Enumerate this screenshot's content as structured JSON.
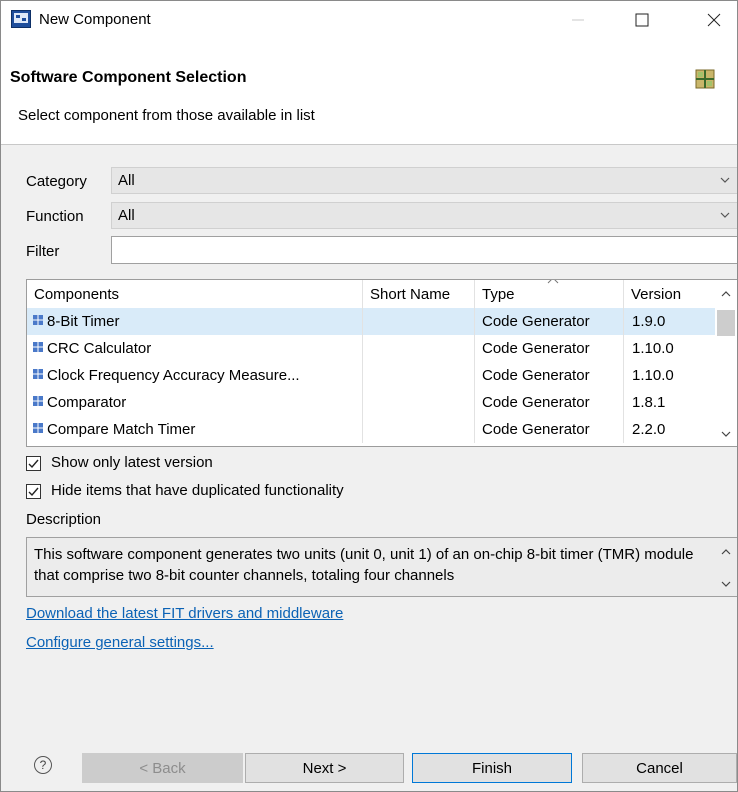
{
  "window": {
    "title": "New Component"
  },
  "banner": {
    "title": "Software Component Selection",
    "subtitle": "Select component from those available in list"
  },
  "filters": {
    "category_label": "Category",
    "category_value": "All",
    "function_label": "Function",
    "function_value": "All",
    "filter_label": "Filter",
    "filter_value": ""
  },
  "table": {
    "columns": [
      "Components",
      "Short Name",
      "Type",
      "Version"
    ],
    "rows": [
      {
        "name": "8-Bit Timer",
        "short": "",
        "type": "Code Generator",
        "version": "1.9.0",
        "selected": true
      },
      {
        "name": "CRC Calculator",
        "short": "",
        "type": "Code Generator",
        "version": "1.10.0",
        "selected": false
      },
      {
        "name": "Clock Frequency Accuracy Measure...",
        "short": "",
        "type": "Code Generator",
        "version": "1.10.0",
        "selected": false
      },
      {
        "name": "Comparator",
        "short": "",
        "type": "Code Generator",
        "version": "1.8.1",
        "selected": false
      },
      {
        "name": "Compare Match Timer",
        "short": "",
        "type": "Code Generator",
        "version": "2.2.0",
        "selected": false
      }
    ]
  },
  "options": {
    "latest_version": "Show only latest version",
    "latest_version_checked": true,
    "hide_duplicates": "Hide items that have duplicated functionality",
    "hide_duplicates_checked": true
  },
  "description": {
    "label": "Description",
    "text": "This software component generates two units (unit 0, unit 1) of an on-chip 8-bit timer (TMR) module that comprise two 8-bit counter channels, totaling four channels"
  },
  "links": {
    "download": "Download the latest FIT drivers and middleware",
    "configure": "Configure general settings..."
  },
  "buttons": {
    "back": "< Back",
    "next": "Next >",
    "finish": "Finish",
    "cancel": "Cancel"
  },
  "icons": {
    "app": "component-app-icon",
    "banner": "component-grid-icon",
    "row": "component-plus-icon",
    "help": "help-icon"
  },
  "colors": {
    "selection": "#d9ebf9",
    "link": "#0b62b5",
    "primary_border": "#0078d7"
  }
}
